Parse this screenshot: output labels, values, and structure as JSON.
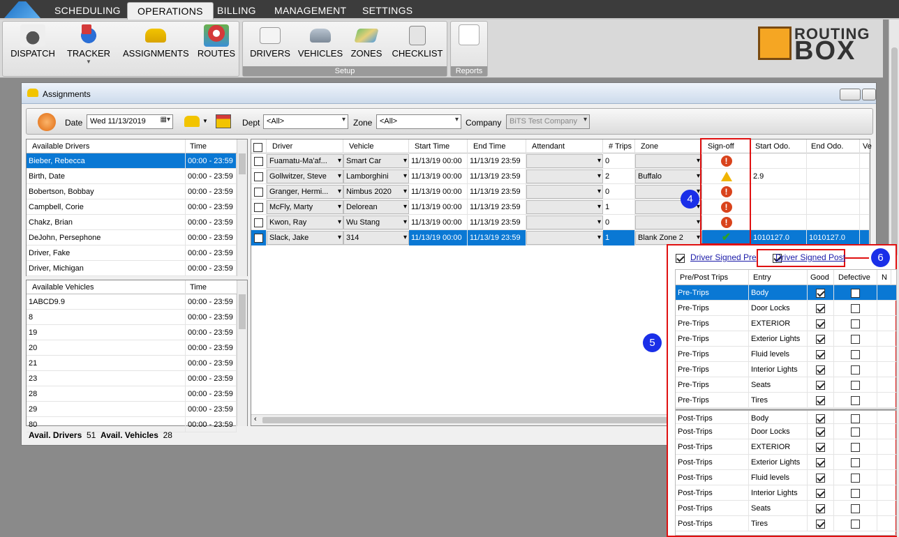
{
  "menu": {
    "tabs": [
      "SCHEDULING",
      "OPERATIONS",
      "BILLING",
      "MANAGEMENT",
      "SETTINGS"
    ],
    "active": "OPERATIONS"
  },
  "ribbon": {
    "buttons": [
      "DISPATCH",
      "TRACKER",
      "ASSIGNMENTS",
      "ROUTES",
      "DRIVERS",
      "VEHICLES",
      "ZONES",
      "CHECKLIST"
    ],
    "groups": {
      "setup": "Setup",
      "reports": "Reports"
    },
    "logo": {
      "line1": "ROUTING",
      "line2": "BOX"
    }
  },
  "window": {
    "title": "Assignments"
  },
  "toolbar": {
    "date_label": "Date",
    "date_value": "Wed 11/13/2019",
    "dept_label": "Dept",
    "dept_value": "<All>",
    "zone_label": "Zone",
    "zone_value": "<All>",
    "company_label": "Company",
    "company_value": "BiTS Test Company"
  },
  "drivers": {
    "headers": [
      "Available Drivers",
      "Time"
    ],
    "rows": [
      {
        "name": "Bieber, Rebecca",
        "time": "00:00 - 23:59"
      },
      {
        "name": "Birth, Date",
        "time": "00:00 - 23:59"
      },
      {
        "name": "Bobertson, Bobbay",
        "time": "00:00 - 23:59"
      },
      {
        "name": "Campbell, Corie",
        "time": "00:00 - 23:59"
      },
      {
        "name": "Chakz, Brian",
        "time": "00:00 - 23:59"
      },
      {
        "name": "DeJohn, Persephone",
        "time": "00:00 - 23:59"
      },
      {
        "name": "Driver, Fake",
        "time": "00:00 - 23:59"
      },
      {
        "name": "Driver, Michigan",
        "time": "00:00 - 23:59"
      }
    ]
  },
  "vehicles": {
    "headers": [
      "Available Vehicles",
      "Time"
    ],
    "rows": [
      {
        "name": "1ABCD9.9",
        "time": "00:00 - 23:59"
      },
      {
        "name": "8",
        "time": "00:00 - 23:59"
      },
      {
        "name": "19",
        "time": "00:00 - 23:59"
      },
      {
        "name": "20",
        "time": "00:00 - 23:59"
      },
      {
        "name": "21",
        "time": "00:00 - 23:59"
      },
      {
        "name": "23",
        "time": "00:00 - 23:59"
      },
      {
        "name": "28",
        "time": "00:00 - 23:59"
      },
      {
        "name": "29",
        "time": "00:00 - 23:59"
      },
      {
        "name": "80",
        "time": "00:00 - 23:59"
      }
    ]
  },
  "status": {
    "drivers_label": "Avail. Drivers",
    "drivers_count": "51",
    "vehicles_label": "Avail. Vehicles",
    "vehicles_count": "28"
  },
  "assignments": {
    "headers": [
      "Driver",
      "Vehicle",
      "Start Time",
      "End Time",
      "Attendant",
      "# Trips",
      "Zone",
      "Sign-off",
      "Start Odo.",
      "End Odo.",
      "Ve"
    ],
    "rows": [
      {
        "driver": "Fuamatu-Ma'af...",
        "vehicle": "Smart Car",
        "start": "11/13/19 00:00",
        "end": "11/13/19 23:59",
        "trips": "0",
        "zone": "",
        "signoff": "error",
        "sodo": "",
        "eodo": ""
      },
      {
        "driver": "Gollwitzer, Steve",
        "vehicle": "Lamborghini",
        "start": "11/13/19 00:00",
        "end": "11/13/19 23:59",
        "trips": "2",
        "zone": "Buffalo",
        "signoff": "warning",
        "sodo": "2.9",
        "eodo": ""
      },
      {
        "driver": "Granger, Hermi...",
        "vehicle": "Nimbus 2020",
        "start": "11/13/19 00:00",
        "end": "11/13/19 23:59",
        "trips": "0",
        "zone": "",
        "signoff": "error",
        "sodo": "",
        "eodo": ""
      },
      {
        "driver": "McFly, Marty",
        "vehicle": "Delorean",
        "start": "11/13/19 00:00",
        "end": "11/13/19 23:59",
        "trips": "1",
        "zone": "",
        "signoff": "error",
        "sodo": "",
        "eodo": ""
      },
      {
        "driver": "Kwon, Ray",
        "vehicle": "Wu Stang",
        "start": "11/13/19 00:00",
        "end": "11/13/19 23:59",
        "trips": "0",
        "zone": "",
        "signoff": "error",
        "sodo": "",
        "eodo": ""
      },
      {
        "driver": "Slack, Jake",
        "vehicle": "314",
        "start": "11/13/19 00:00",
        "end": "11/13/19 23:59",
        "trips": "1",
        "zone": "Blank Zone 2",
        "signoff": "ok",
        "sodo": "1010127.0",
        "eodo": "1010127.0"
      }
    ]
  },
  "popup": {
    "pre_link": "Driver Signed Pre",
    "post_link": "Driver Signed Post",
    "headers": [
      "Pre/Post Trips",
      "Entry",
      "Good",
      "Defective",
      "N"
    ],
    "rows": [
      {
        "trip": "Pre-Trips",
        "entry": "Body"
      },
      {
        "trip": "Pre-Trips",
        "entry": "Door Locks"
      },
      {
        "trip": "Pre-Trips",
        "entry": "EXTERIOR"
      },
      {
        "trip": "Pre-Trips",
        "entry": "Exterior Lights"
      },
      {
        "trip": "Pre-Trips",
        "entry": "Fluid levels"
      },
      {
        "trip": "Pre-Trips",
        "entry": "Interior Lights"
      },
      {
        "trip": "Pre-Trips",
        "entry": "Seats"
      },
      {
        "trip": "Pre-Trips",
        "entry": "Tires"
      },
      {
        "trip": "Post-Trips",
        "entry": "Body"
      },
      {
        "trip": "Post-Trips",
        "entry": "Door Locks"
      },
      {
        "trip": "Post-Trips",
        "entry": "EXTERIOR"
      },
      {
        "trip": "Post-Trips",
        "entry": "Exterior Lights"
      },
      {
        "trip": "Post-Trips",
        "entry": "Fluid levels"
      },
      {
        "trip": "Post-Trips",
        "entry": "Interior Lights"
      },
      {
        "trip": "Post-Trips",
        "entry": "Seats"
      },
      {
        "trip": "Post-Trips",
        "entry": "Tires"
      }
    ]
  },
  "callouts": [
    "4",
    "5",
    "6"
  ],
  "colors": {
    "selection": "#0a78d4",
    "highlight": "#e01010",
    "callout": "#1a2fe8"
  }
}
